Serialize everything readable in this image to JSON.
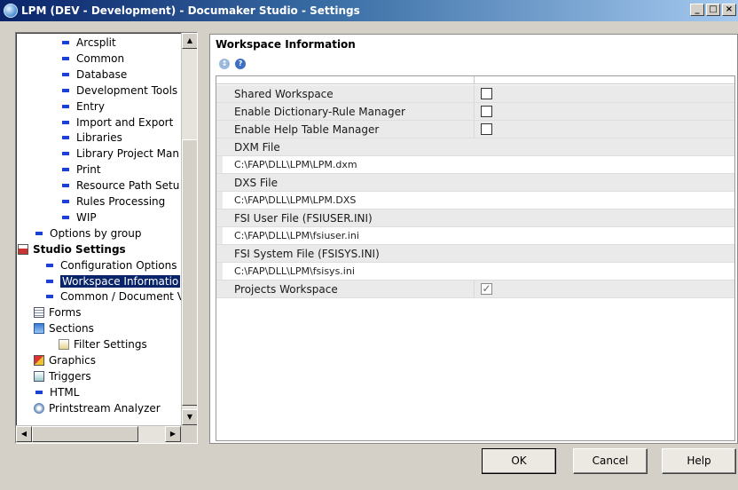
{
  "window": {
    "title": "LPM (DEV - Development)  - Documaker Studio - Settings",
    "controls": [
      "_",
      "□",
      "×"
    ]
  },
  "tree": {
    "items": [
      {
        "label": "Arcsplit",
        "icon": "bullet-icon"
      },
      {
        "label": "Common",
        "icon": "bullet-icon"
      },
      {
        "label": "Database",
        "icon": "bullet-icon"
      },
      {
        "label": "Development Tools",
        "icon": "bullet-icon"
      },
      {
        "label": "Entry",
        "icon": "bullet-icon"
      },
      {
        "label": "Import and Export",
        "icon": "bullet-icon"
      },
      {
        "label": "Libraries",
        "icon": "bullet-icon"
      },
      {
        "label": "Library Project Man",
        "icon": "bullet-icon"
      },
      {
        "label": "Print",
        "icon": "bullet-icon"
      },
      {
        "label": "Resource Path Setu",
        "icon": "bullet-icon"
      },
      {
        "label": "Rules Processing",
        "icon": "bullet-icon"
      },
      {
        "label": "WIP",
        "icon": "bullet-icon"
      },
      {
        "label": "Options by group",
        "icon": "bullet-icon"
      },
      {
        "label": "Studio Settings",
        "icon": "settings-icon"
      },
      {
        "label": "Configuration Options",
        "icon": "bullet-icon"
      },
      {
        "label": "Workspace Informatio",
        "icon": "bullet-icon"
      },
      {
        "label": "Common / Document V",
        "icon": "bullet-icon"
      },
      {
        "label": "Forms",
        "icon": "forms-icon"
      },
      {
        "label": "Sections",
        "icon": "sections-icon"
      },
      {
        "label": "Filter Settings",
        "icon": "filter-icon"
      },
      {
        "label": "Graphics",
        "icon": "graphics-icon"
      },
      {
        "label": "Triggers",
        "icon": "triggers-icon"
      },
      {
        "label": "HTML",
        "icon": "html-icon"
      },
      {
        "label": "Printstream Analyzer",
        "icon": "analyzer-icon"
      }
    ],
    "selected": "Workspace Informatio"
  },
  "panel": {
    "title": "Workspace Information",
    "icons": [
      "sort-icon",
      "help-icon"
    ],
    "rows": [
      {
        "label": "Shared Workspace",
        "kind": "checkbox",
        "checked": false
      },
      {
        "label": "Enable Dictionary-Rule Manager",
        "kind": "checkbox",
        "checked": false
      },
      {
        "label": "Enable Help Table Manager",
        "kind": "checkbox",
        "checked": false
      },
      {
        "label": "DXM File",
        "kind": "header"
      },
      {
        "label": "C:\\FAP\\DLL\\LPM\\LPM.dxm",
        "kind": "value"
      },
      {
        "label": "DXS File",
        "kind": "header"
      },
      {
        "label": "C:\\FAP\\DLL\\LPM\\LPM.DXS",
        "kind": "value"
      },
      {
        "label": "FSI User File (FSIUSER.INI)",
        "kind": "header"
      },
      {
        "label": "C:\\FAP\\DLL\\LPM\\fsiuser.ini",
        "kind": "value"
      },
      {
        "label": "FSI System File (FSISYS.INI)",
        "kind": "header"
      },
      {
        "label": "C:\\FAP\\DLL\\LPM\\fsisys.ini",
        "kind": "value"
      },
      {
        "label": "Projects Workspace",
        "kind": "checkbox",
        "checked": true
      }
    ]
  },
  "buttons": {
    "ok": "OK",
    "cancel": "Cancel",
    "help": "Help"
  }
}
